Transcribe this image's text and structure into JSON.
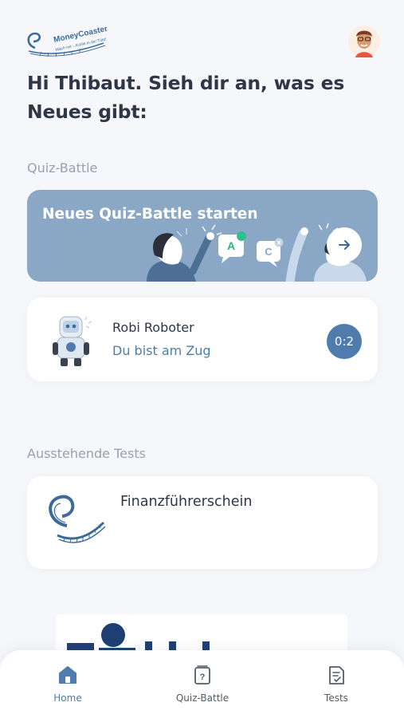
{
  "header": {
    "logo_text": "MoneyCoaster",
    "logo_tagline": "Mach mit – Kohle in der Tüte!",
    "greeting": "Hi Thibaut. Sieh dir an, was es Neues gibt:"
  },
  "quiz_section": {
    "label": "Quiz-Battle",
    "banner_title": "Neues Quiz-Battle starten",
    "bubble_a": "A",
    "bubble_c": "C",
    "battle": {
      "opponent": "Robi Roboter",
      "status": "Du bist am Zug",
      "score": "0:2"
    }
  },
  "tests_section": {
    "label": "Ausstehende Tests",
    "test_title": "Finanzführerschein"
  },
  "tabbar": {
    "home": "Home",
    "quiz": "Quiz-Battle",
    "tests": "Tests"
  },
  "colors": {
    "accent": "#4f7cac",
    "banner": "#8aa8c6",
    "background": "#f6f7fa"
  }
}
